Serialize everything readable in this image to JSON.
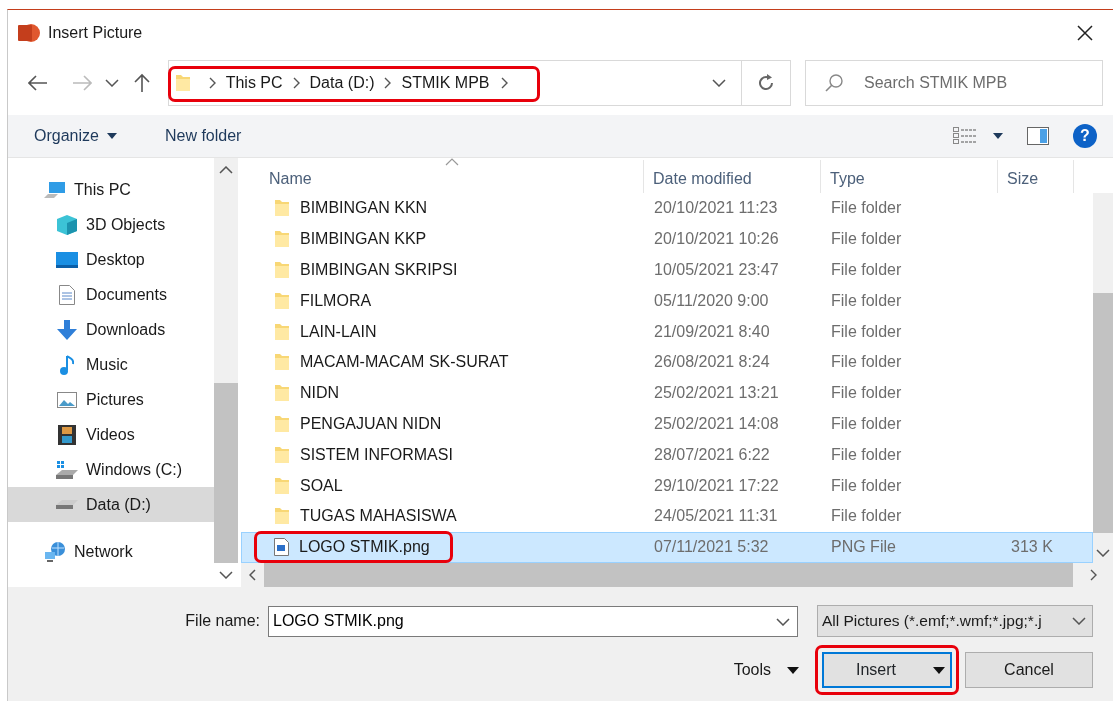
{
  "window": {
    "title": "Insert Picture"
  },
  "address": {
    "crumbs": [
      "This PC",
      "Data (D:)",
      "STMIK MPB"
    ],
    "highlighted": true
  },
  "search": {
    "placeholder": "Search STMIK MPB"
  },
  "toolbar": {
    "organize": "Organize",
    "new_folder": "New folder",
    "help": "?"
  },
  "nav": [
    {
      "label": "This PC",
      "selected": false,
      "children": [
        {
          "label": "3D Objects",
          "selected": false
        },
        {
          "label": "Desktop",
          "selected": false
        },
        {
          "label": "Documents",
          "selected": false
        },
        {
          "label": "Downloads",
          "selected": false
        },
        {
          "label": "Music",
          "selected": false
        },
        {
          "label": "Pictures",
          "selected": false
        },
        {
          "label": "Videos",
          "selected": false
        },
        {
          "label": "Windows (C:)",
          "selected": false
        },
        {
          "label": "Data (D:)",
          "selected": true
        }
      ]
    },
    {
      "label": "Network",
      "selected": false
    }
  ],
  "columns": [
    "Name",
    "Date modified",
    "Type",
    "Size"
  ],
  "files": [
    {
      "kind": "folder",
      "name": "BIMBINGAN KKN",
      "date": "20/10/2021 11:23",
      "type": "File folder",
      "selected": false,
      "highlighted": false
    },
    {
      "kind": "folder",
      "name": "BIMBINGAN KKP",
      "date": "20/10/2021 10:26",
      "type": "File folder",
      "selected": false,
      "highlighted": false
    },
    {
      "kind": "folder",
      "name": "BIMBINGAN SKRIPSI",
      "date": "10/05/2021 23:47",
      "type": "File folder",
      "selected": false,
      "highlighted": false
    },
    {
      "kind": "folder",
      "name": "FILMORA",
      "date": "05/11/2020 9:00",
      "type": "File folder",
      "selected": false,
      "highlighted": false
    },
    {
      "kind": "folder",
      "name": "LAIN-LAIN",
      "date": "21/09/2021 8:40",
      "type": "File folder",
      "selected": false,
      "highlighted": false
    },
    {
      "kind": "folder",
      "name": "MACAM-MACAM SK-SURAT",
      "date": "26/08/2021 8:24",
      "type": "File folder",
      "selected": false,
      "highlighted": false
    },
    {
      "kind": "folder",
      "name": "NIDN",
      "date": "25/02/2021 13:21",
      "type": "File folder",
      "selected": false,
      "highlighted": false
    },
    {
      "kind": "folder",
      "name": "PENGAJUAN NIDN",
      "date": "25/02/2021 14:08",
      "type": "File folder",
      "selected": false,
      "highlighted": false
    },
    {
      "kind": "folder",
      "name": "SISTEM INFORMASI",
      "date": "28/07/2021 6:22",
      "type": "File folder",
      "selected": false,
      "highlighted": false
    },
    {
      "kind": "folder",
      "name": "SOAL",
      "date": "29/10/2021 17:22",
      "type": "File folder",
      "selected": false,
      "highlighted": false
    },
    {
      "kind": "folder",
      "name": "TUGAS MAHASISWA",
      "date": "24/05/2021 11:31",
      "type": "File folder",
      "selected": false,
      "highlighted": false
    },
    {
      "kind": "image",
      "name": "LOGO STMIK.png",
      "date": "07/11/2021 5:32",
      "type": "PNG File",
      "size": "313 K",
      "selected": true,
      "highlighted": true
    }
  ],
  "file_name": {
    "label": "File name:",
    "value": "LOGO STMIK.png"
  },
  "filter": {
    "value": "All Pictures (*.emf;*.wmf;*.jpg;*.j"
  },
  "buttons": {
    "tools": "Tools",
    "insert": "Insert",
    "insert_highlighted": true,
    "cancel": "Cancel"
  }
}
